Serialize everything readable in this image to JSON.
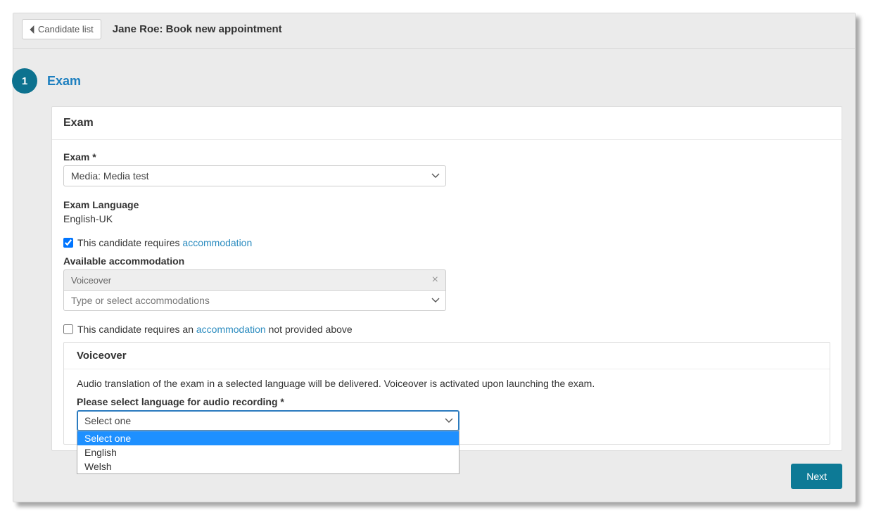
{
  "topbar": {
    "back_label": "Candidate list",
    "title": "Jane Roe: Book new appointment"
  },
  "step": {
    "number": "1",
    "title": "Exam"
  },
  "panel": {
    "heading": "Exam",
    "exam_label": "Exam *",
    "exam_value": "Media: Media test",
    "language_label": "Exam Language",
    "language_value": "English-UK",
    "accommodation_checkbox_prefix": "This candidate requires ",
    "accommodation_link": "accommodation",
    "available_accommodation_label": "Available accommodation",
    "accommodation_chip": "Voiceover",
    "accommodation_placeholder": "Type or select accommodations",
    "other_accommodation_prefix": "This candidate requires an ",
    "other_accommodation_link": "accommodation",
    "other_accommodation_suffix": " not provided above",
    "voiceover_heading": "Voiceover",
    "voiceover_desc": "Audio translation of the exam in a selected language will be delivered. Voiceover is activated upon launching the exam.",
    "voiceover_select_label": "Please select language for audio recording *",
    "voiceover_select_value": "Select one",
    "voiceover_options": [
      "Select one",
      "English",
      "Welsh"
    ]
  },
  "footer": {
    "next_label": "Next"
  }
}
